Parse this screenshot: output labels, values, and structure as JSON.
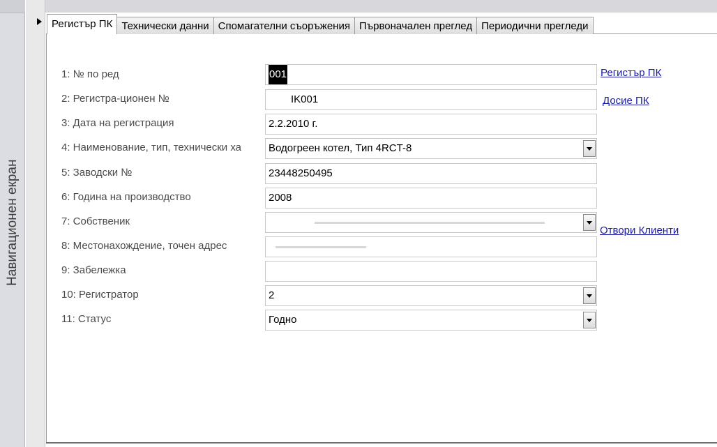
{
  "nav": {
    "label": "Навигационен екран"
  },
  "tabs": [
    {
      "label": "Регистър ПК"
    },
    {
      "label": "Технически данни"
    },
    {
      "label": "Спомагателни съоръжения"
    },
    {
      "label": "Първоначален преглед"
    },
    {
      "label": "Периодични прегледи"
    }
  ],
  "form": {
    "fields": [
      {
        "label": "1: № по ред",
        "value": "001"
      },
      {
        "label": "2: Регистра-ционен №",
        "value": "IK001"
      },
      {
        "label": "3: Дата на регистрация",
        "value": "2.2.2010 г."
      },
      {
        "label": "4: Наименование, тип, технически ха",
        "value": "Водогреен котел, Тип 4RCT-8"
      },
      {
        "label": "5: Заводски №",
        "value": "23448250495"
      },
      {
        "label": "6: Година на производство",
        "value": "2008"
      },
      {
        "label": "7: Собственик",
        "value": ""
      },
      {
        "label": "8: Местонахождение, точен адрес",
        "value": ""
      },
      {
        "label": "9: Забележка",
        "value": ""
      },
      {
        "label": "10: Регистратор",
        "value": "2"
      },
      {
        "label": "11: Статус",
        "value": "Годно"
      }
    ]
  },
  "links": {
    "registry": "Регистър ПК",
    "dossier": "Досие ПК",
    "open_clients": "Отвори Клиенти"
  }
}
